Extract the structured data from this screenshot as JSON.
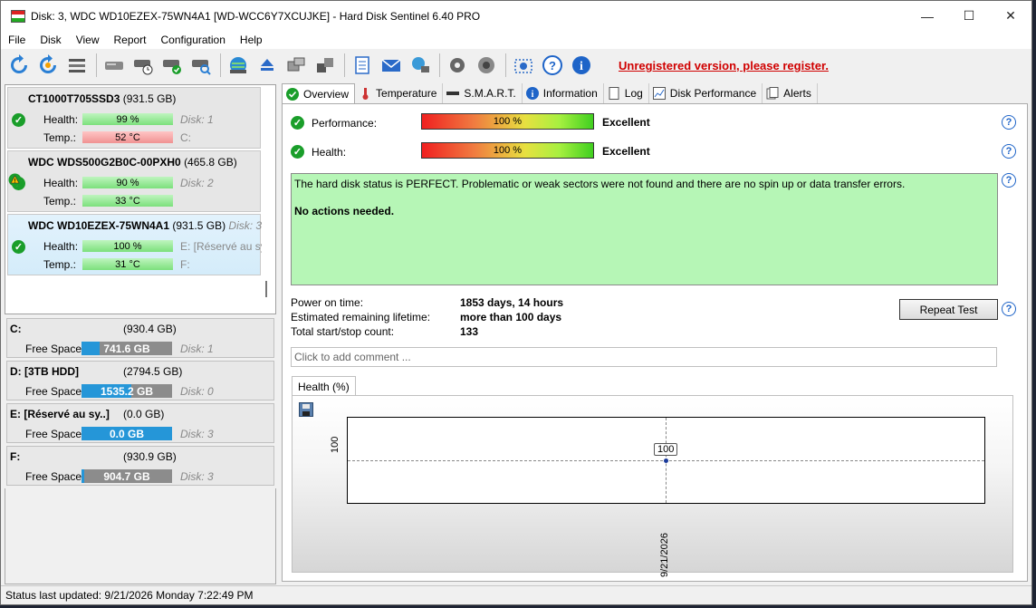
{
  "window": {
    "title": "Disk: 3, WDC WD10EZEX-75WN4A1 [WD-WCC6Y7XCUJKE]  -  Hard Disk Sentinel 6.40 PRO"
  },
  "menu": [
    "File",
    "Disk",
    "View",
    "Report",
    "Configuration",
    "Help"
  ],
  "toolbar": {
    "icons": [
      "refresh-icon",
      "refresh-all-icon",
      "disk-list-icon",
      "disk-icon",
      "disk-timer-icon",
      "disk-check-icon",
      "disk-search-icon",
      "globe-icon",
      "eject-icon",
      "drives-icon",
      "disk-copy-icon",
      "report-icon",
      "mail-icon",
      "network-icon",
      "gear-icon",
      "speaker-icon",
      "screenshot-icon",
      "help-icon",
      "info-icon"
    ],
    "register_text": "Unregistered version, please register."
  },
  "disks": [
    {
      "name": "CT1000T705SSD3",
      "size": "(931.5 GB)",
      "health_label": "Health:",
      "health": "99 %",
      "health_pct": 99,
      "temp_label": "Temp.:",
      "temp": "52 °C",
      "temp_status": "hot",
      "disk_no": "Disk: 1",
      "volumes": "C:"
    },
    {
      "name": "WDC WDS500G2B0C-00PXH0",
      "size": "(465.8 GB)",
      "health_label": "Health:",
      "health": "90 %",
      "health_pct": 90,
      "temp_label": "Temp.:",
      "temp": "33 °C",
      "temp_status": "ok",
      "disk_no": "Disk: 2",
      "volumes": ""
    },
    {
      "name": "WDC WD10EZEX-75WN4A1",
      "size": "(931.5 GB)",
      "size_extra": "Disk: 3",
      "health_label": "Health:",
      "health": "100 %",
      "health_pct": 100,
      "temp_label": "Temp.:",
      "temp": "31 °C",
      "temp_status": "ok",
      "disk_no": "E: [Réservé au sys",
      "volumes": "F:"
    }
  ],
  "volumes": [
    {
      "name": "C:",
      "size": "(930.4 GB)",
      "label": "Free Space",
      "free": "741.6 GB",
      "free_frac": 0.2,
      "disk": "Disk: 1"
    },
    {
      "name": "D: [3TB HDD]",
      "size": "(2794.5 GB)",
      "label": "Free Space",
      "free": "1535.2 GB",
      "free_frac": 0.55,
      "disk": "Disk: 0"
    },
    {
      "name": "E: [Réservé au sy..]",
      "size": "(0.0 GB)",
      "label": "Free Space",
      "free": "0.0 GB",
      "free_frac": 1.0,
      "disk": "Disk: 3"
    },
    {
      "name": "F:",
      "size": "(930.9 GB)",
      "label": "Free Space",
      "free": "904.7 GB",
      "free_frac": 0.03,
      "disk": "Disk: 3"
    }
  ],
  "tabs": [
    "Overview",
    "Temperature",
    "S.M.A.R.T.",
    "Information",
    "Log",
    "Disk Performance",
    "Alerts"
  ],
  "overview": {
    "performance_label": "Performance:",
    "performance": "100 %",
    "performance_rating": "Excellent",
    "health_label": "Health:",
    "health": "100 %",
    "health_rating": "Excellent",
    "status_text": "The hard disk status is PERFECT. Problematic or weak sectors were not found and there are no spin up or data transfer errors.",
    "status_action": "No actions needed.",
    "power_on_label": "Power on time:",
    "power_on": "1853 days, 14 hours",
    "lifetime_label": "Estimated remaining lifetime:",
    "lifetime": "more than 100 days",
    "startstop_label": "Total start/stop count:",
    "startstop": "133",
    "repeat_button": "Repeat Test",
    "comment_placeholder": "Click to add comment ..."
  },
  "chart_data": {
    "type": "line",
    "tab": "Health (%)",
    "x": [
      "9/21/2026"
    ],
    "series": [
      {
        "values": [
          100
        ]
      }
    ],
    "ylabel": "100",
    "xlabel": "9/21/2026",
    "point_label": "100"
  },
  "statusbar": {
    "text": "Status last updated: 9/21/2026 Monday 7:22:49 PM"
  }
}
